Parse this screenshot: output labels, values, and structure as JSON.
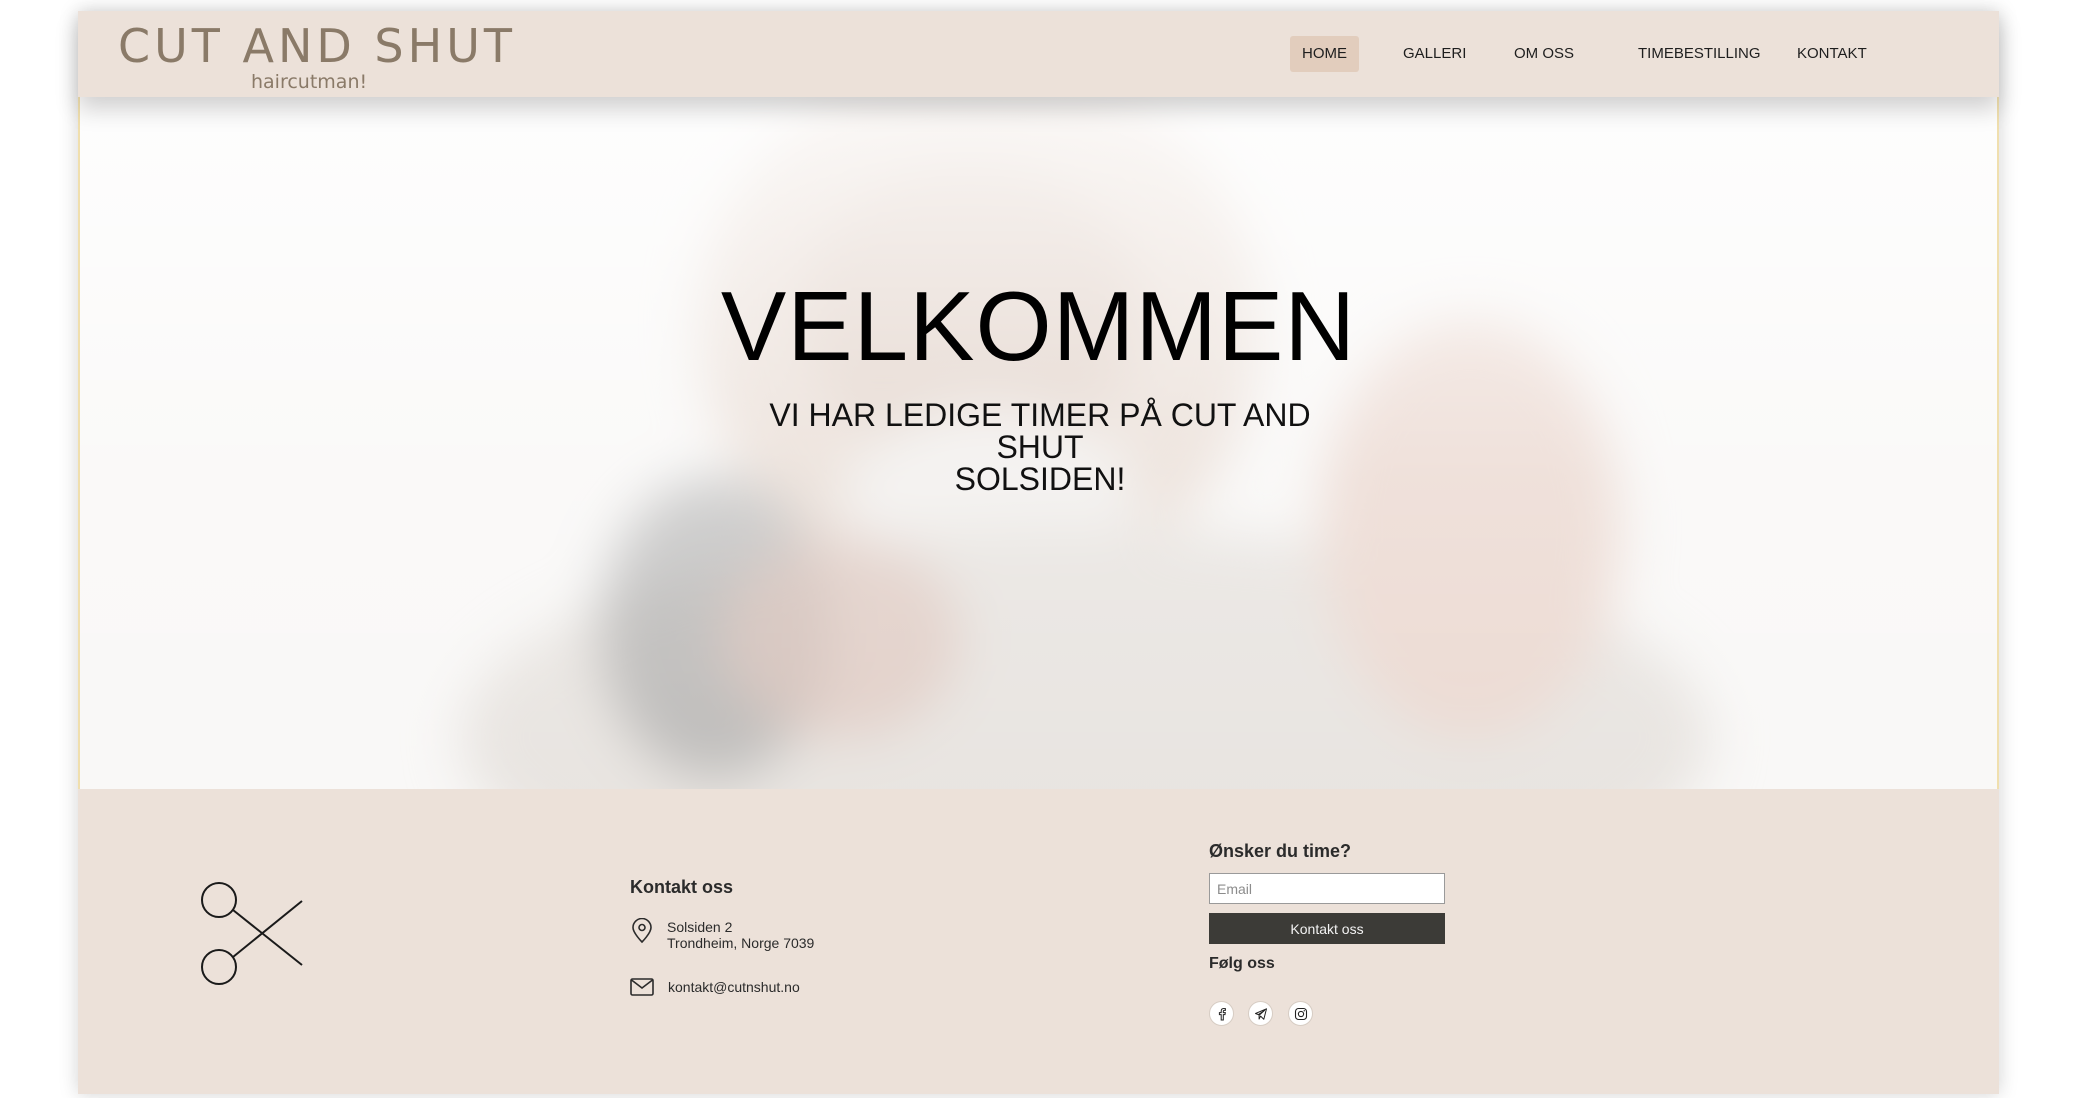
{
  "brand": {
    "name": "CUT AND SHUT",
    "tagline": "haircutman!",
    "color": "#8a7a68"
  },
  "nav": {
    "items": [
      {
        "label": "HOME",
        "active": true
      },
      {
        "label": "GALLERI",
        "active": false
      },
      {
        "label": "OM OSS",
        "active": false
      },
      {
        "label": "TIMEBESTILLING",
        "active": false
      },
      {
        "label": "KONTAKT",
        "active": false
      }
    ]
  },
  "hero": {
    "title": "VELKOMMEN",
    "subtitle_line1": "VI HAR LEDIGE TIMER PÅ CUT AND SHUT",
    "subtitle_line2": "SOLSIDEN!"
  },
  "footer": {
    "logo_icon": "scissors-icon",
    "contact": {
      "title": "Kontakt oss",
      "address_line1": "Solsiden 2",
      "address_line2": "Trondheim, Norge 7039",
      "email": "kontakt@cutnshut.no"
    },
    "booking": {
      "title": "Ønsker du time?",
      "email_placeholder": "Email",
      "button_label": "Kontakt oss"
    },
    "follow": {
      "title": "Følg oss",
      "icons": [
        "facebook-icon",
        "telegram-icon",
        "instagram-icon"
      ]
    }
  },
  "colors": {
    "header_bg": "#ece1d9",
    "nav_active_bg": "#e2cdbd",
    "footer_bg": "#ece1d9",
    "button_bg": "#3c3b37"
  }
}
